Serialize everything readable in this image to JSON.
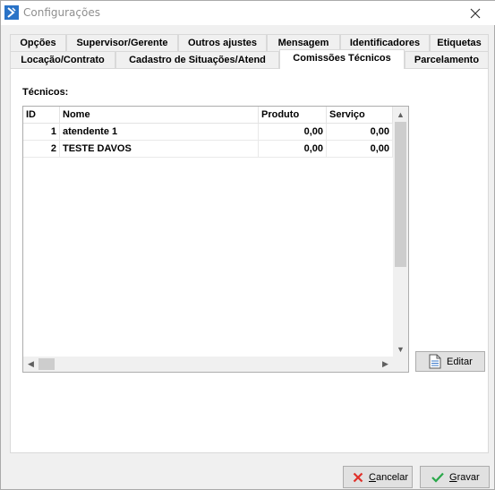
{
  "window": {
    "title": "Configurações"
  },
  "tabs": {
    "row1": [
      "Opções",
      "Supervisor/Gerente",
      "Outros ajustes",
      "Mensagem",
      "Identificadores",
      "Etiquetas"
    ],
    "row2": [
      "Locação/Contrato",
      "Cadastro de Situações/Atend",
      "Comissões Técnicos",
      "Parcelamento"
    ],
    "selected": "Comissões Técnicos"
  },
  "panel": {
    "section_label": "Técnicos:",
    "grid": {
      "columns": [
        "ID",
        "Nome",
        "Produto",
        "Serviço"
      ],
      "rows": [
        [
          "1",
          "atendente 1",
          "0,00",
          "0,00"
        ],
        [
          "2",
          "TESTE DAVOS",
          "0,00",
          "0,00"
        ]
      ]
    },
    "edit_button": "Editar"
  },
  "footer": {
    "cancel_first": "C",
    "cancel_rest": "ancelar",
    "save_first": "G",
    "save_rest": "ravar"
  },
  "colors": {
    "cancel_icon": "#e0302a",
    "save_icon": "#2aa84a",
    "title_icon": "#2a73c7"
  }
}
